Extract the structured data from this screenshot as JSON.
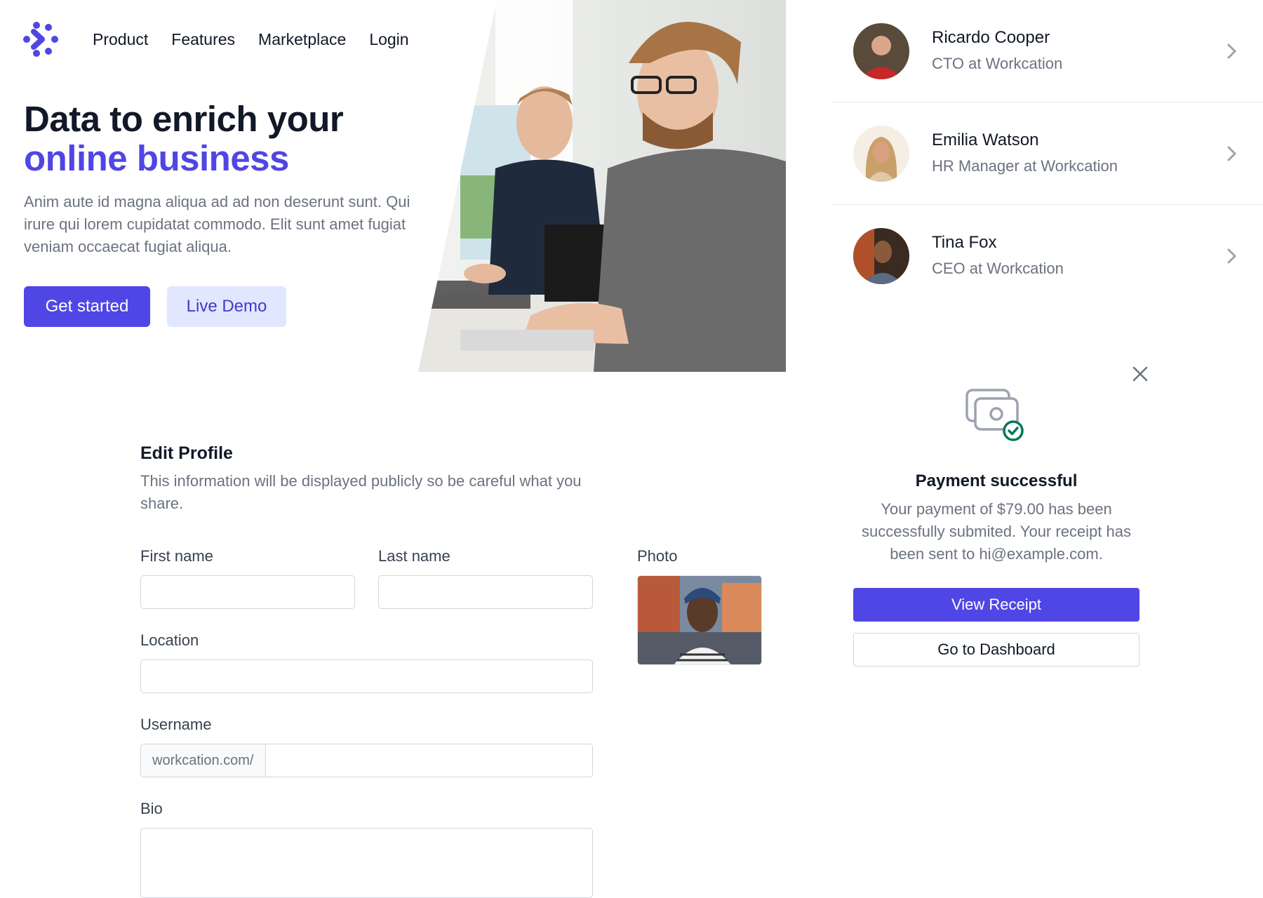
{
  "nav": {
    "logo_icon": "brand-logo-icon",
    "items": [
      "Product",
      "Features",
      "Marketplace",
      "Login"
    ]
  },
  "hero": {
    "title_line1": "Data to enrich your",
    "title_line2": "online business",
    "description": "Anim aute id magna aliqua ad ad non deserunt sunt. Qui irure qui lorem cupidatat commodo. Elit sunt amet fugiat veniam occaecat fugiat aliqua.",
    "primary_button": "Get started",
    "secondary_button": "Live Demo",
    "accent_color": "#4f46e5"
  },
  "people": [
    {
      "name": "Ricardo Cooper",
      "role": "CTO at Workcation"
    },
    {
      "name": "Emilia Watson",
      "role": "HR Manager at Workcation"
    },
    {
      "name": "Tina Fox",
      "role": "CEO at Workcation"
    }
  ],
  "payment": {
    "icon": "cash-check-icon",
    "title": "Payment successful",
    "description": "Your payment of $79.00 has been successfully submited. Your receipt has been sent to hi@example.com.",
    "primary_button": "View Receipt",
    "secondary_button": "Go to Dashboard",
    "success_color": "#047857"
  },
  "profile": {
    "title": "Edit Profile",
    "description": "This information will be displayed publicly so be careful what you share.",
    "first_name_label": "First name",
    "first_name_value": "",
    "last_name_label": "Last name",
    "last_name_value": "",
    "location_label": "Location",
    "location_value": "",
    "username_label": "Username",
    "username_prefix": "workcation.com/",
    "username_value": "",
    "bio_label": "Bio",
    "bio_value": "",
    "photo_label": "Photo"
  }
}
